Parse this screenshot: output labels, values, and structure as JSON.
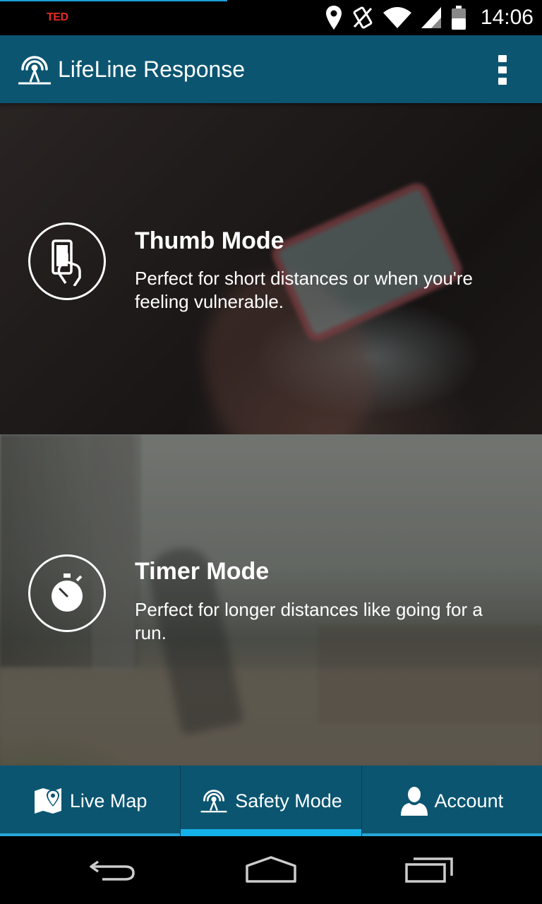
{
  "status_bar": {
    "notification_text": "TED",
    "time": "14:06",
    "icons": [
      "location-icon",
      "vibrate-off-icon",
      "wifi-icon",
      "signal-icon",
      "battery-icon"
    ]
  },
  "app_bar": {
    "title": "LifeLine Response",
    "logo_icon": "signal-tower-icon",
    "menu_icon": "overflow-menu-icon"
  },
  "modes": [
    {
      "title": "Thumb Mode",
      "description": "Perfect for short distances or when you're feeling vulnerable.",
      "icon": "hand-phone-icon"
    },
    {
      "title": "Timer Mode",
      "description": "Perfect for longer distances like going for a run.",
      "icon": "stopwatch-icon"
    }
  ],
  "tabs": [
    {
      "label": "Live Map",
      "icon": "map-pin-icon",
      "active": false
    },
    {
      "label": "Safety Mode",
      "icon": "signal-tower-icon",
      "active": true
    },
    {
      "label": "Account",
      "icon": "person-icon",
      "active": false
    }
  ],
  "nav_bar": {
    "icons": [
      "back-icon",
      "home-icon",
      "recents-icon"
    ]
  },
  "colors": {
    "primary": "#0b5571",
    "accent": "#14b0e8"
  }
}
